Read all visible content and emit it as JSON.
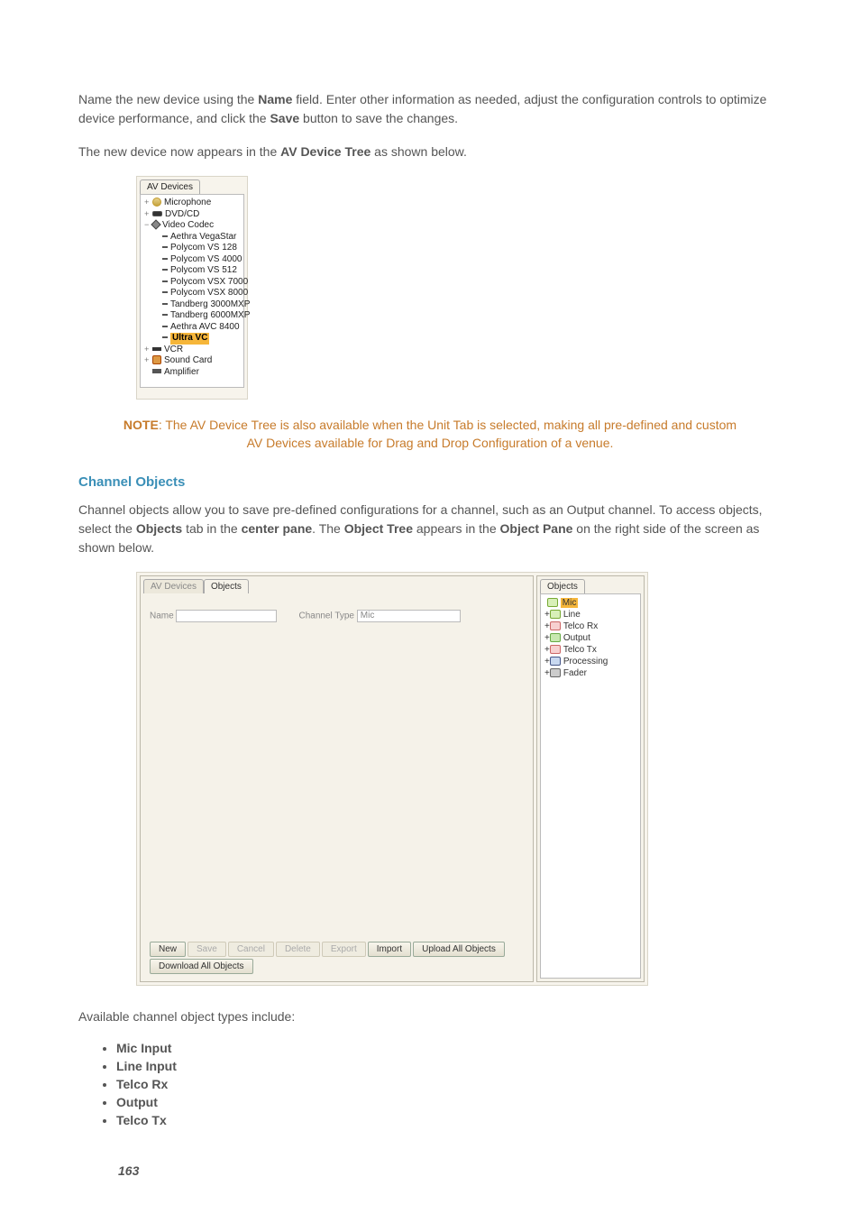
{
  "para1": {
    "t1": "Name the new device using the ",
    "b1": "Name",
    "t2": " field. Enter other information as needed, adjust the configuration controls to optimize device performance, and click the ",
    "b2": "Save",
    "t3": " button to save the changes."
  },
  "para2": {
    "t1": "The new device now appears in the ",
    "b1": "AV Device Tree",
    "t2": " as shown below."
  },
  "tree1": {
    "tab": "AV Devices",
    "items": {
      "microphone": "Microphone",
      "dvdcd": "DVD/CD",
      "video_codec": "Video Codec",
      "vc_children": [
        "Aethra VegaStar",
        "Polycom VS 128",
        "Polycom VS 4000",
        "Polycom VS 512",
        "Polycom VSX 7000",
        "Polycom VSX 8000",
        "Tandberg 3000MXP",
        "Tandberg 6000MXP",
        "Aethra AVC 8400"
      ],
      "selected": "Ultra VC",
      "vcr": "VCR",
      "sound_card": "Sound Card",
      "amplifier": "Amplifier"
    }
  },
  "note": {
    "label": "NOTE",
    "text": ": The AV Device Tree is also available when the Unit Tab is selected, making all pre-defined and custom AV Devices available for Drag and Drop Configuration of a venue."
  },
  "heading": "Channel Objects",
  "para3": {
    "t1": "Channel objects allow you to save pre-defined configurations for a channel, such as an Output channel. To access objects, select the ",
    "b1": "Objects",
    "t2": " tab in the ",
    "b2": "center pane",
    "t3": ". The ",
    "b3": "Object Tree",
    "t4": " appears in the ",
    "b4": "Object Pane",
    "t5": " on the right side of the screen as shown below."
  },
  "centerPane": {
    "tab_av": "AV Devices",
    "tab_obj": "Objects",
    "name_label": "Name",
    "chtype_label": "Channel Type",
    "chtype_value": "Mic",
    "buttons": {
      "new": "New",
      "save": "Save",
      "cancel": "Cancel",
      "delete": "Delete",
      "export": "Export",
      "import": "Import",
      "upload": "Upload All Objects",
      "download": "Download All Objects"
    }
  },
  "rightPane": {
    "tab": "Objects",
    "items": {
      "mic": "Mic",
      "line": "Line",
      "telco_rx": "Telco Rx",
      "output": "Output",
      "telco_tx": "Telco Tx",
      "processing": "Processing",
      "fader": "Fader"
    }
  },
  "para4": "Available channel object types include:",
  "bullets": [
    "Mic Input",
    "Line Input",
    "Telco Rx",
    "Output",
    "Telco Tx"
  ],
  "page_number": "163"
}
